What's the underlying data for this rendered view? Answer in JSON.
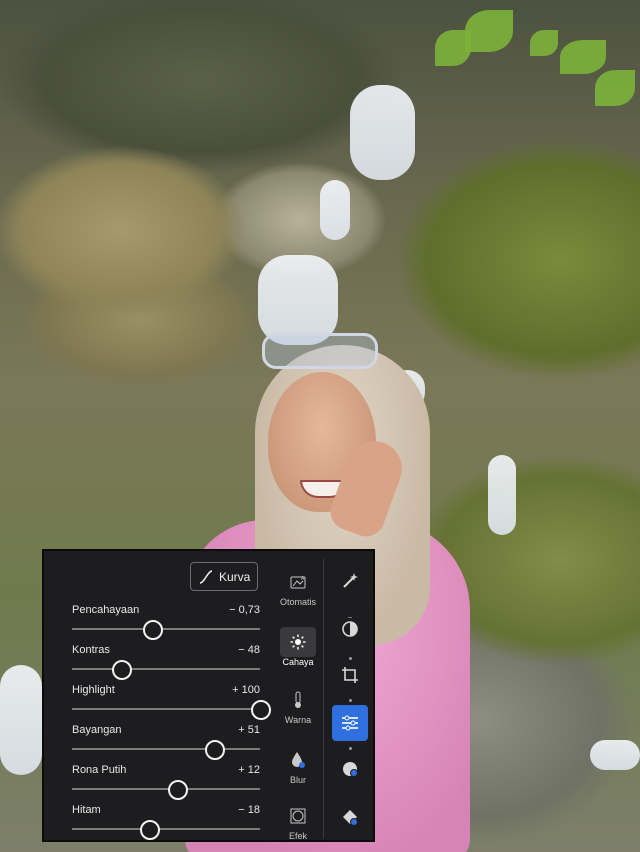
{
  "panel": {
    "curve_button_label": "Kurva",
    "sliders": [
      {
        "label": "Pencahayaan",
        "value": "− 0,73",
        "position": 0.425
      },
      {
        "label": "Kontras",
        "value": "− 48",
        "position": 0.26
      },
      {
        "label": "Highlight",
        "value": "+ 100",
        "position": 1.0
      },
      {
        "label": "Bayangan",
        "value": "+ 51",
        "position": 0.755
      },
      {
        "label": "Rona Putih",
        "value": "+ 12",
        "position": 0.56
      },
      {
        "label": "Hitam",
        "value": "− 18",
        "position": 0.41
      }
    ],
    "tools": [
      {
        "label": "Otomatis",
        "icon": "auto-icon",
        "active": false
      },
      {
        "label": "Cahaya",
        "icon": "sun-icon",
        "active": true
      },
      {
        "label": "Warna",
        "icon": "thermometer-icon",
        "active": false
      },
      {
        "label": "Blur",
        "icon": "droplet-icon",
        "active": false
      },
      {
        "label": "Efek",
        "icon": "vignette-icon",
        "active": false
      }
    ],
    "vertical_tools": [
      {
        "icon": "magic-wand-icon",
        "selected": false
      },
      {
        "icon": "mask-icon",
        "selected": false
      },
      {
        "icon": "crop-icon",
        "selected": false
      },
      {
        "icon": "adjust-sliders-icon",
        "selected": true
      },
      {
        "icon": "presets-icon",
        "selected": false
      },
      {
        "icon": "heal-icon",
        "selected": false
      }
    ],
    "accent_color": "#2f6fde"
  }
}
